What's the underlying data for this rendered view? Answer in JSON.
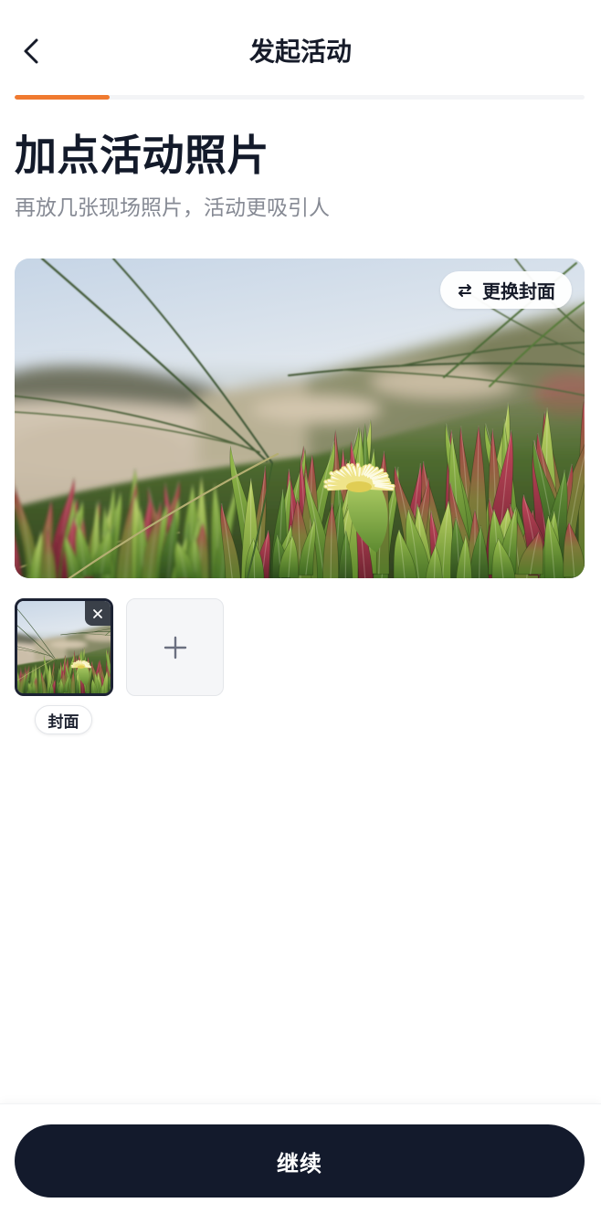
{
  "header": {
    "title": "发起活动",
    "back_icon": "chevron-left-icon"
  },
  "progress": {
    "fraction": 0.167,
    "fill_color": "#F07A30",
    "track_color": "#F3F4F6"
  },
  "intro": {
    "heading": "加点活动照片",
    "subheading": "再放几张现场照片，活动更吸引人"
  },
  "cover": {
    "change_button_label": "更换封面",
    "change_button_icon": "swap-icon"
  },
  "photos": {
    "items": [
      {
        "badge": "封面",
        "remove_icon": "close-icon",
        "selected": true
      }
    ],
    "add_icon": "plus-icon"
  },
  "footer": {
    "continue_label": "继续",
    "button_color": "#131A2C"
  }
}
